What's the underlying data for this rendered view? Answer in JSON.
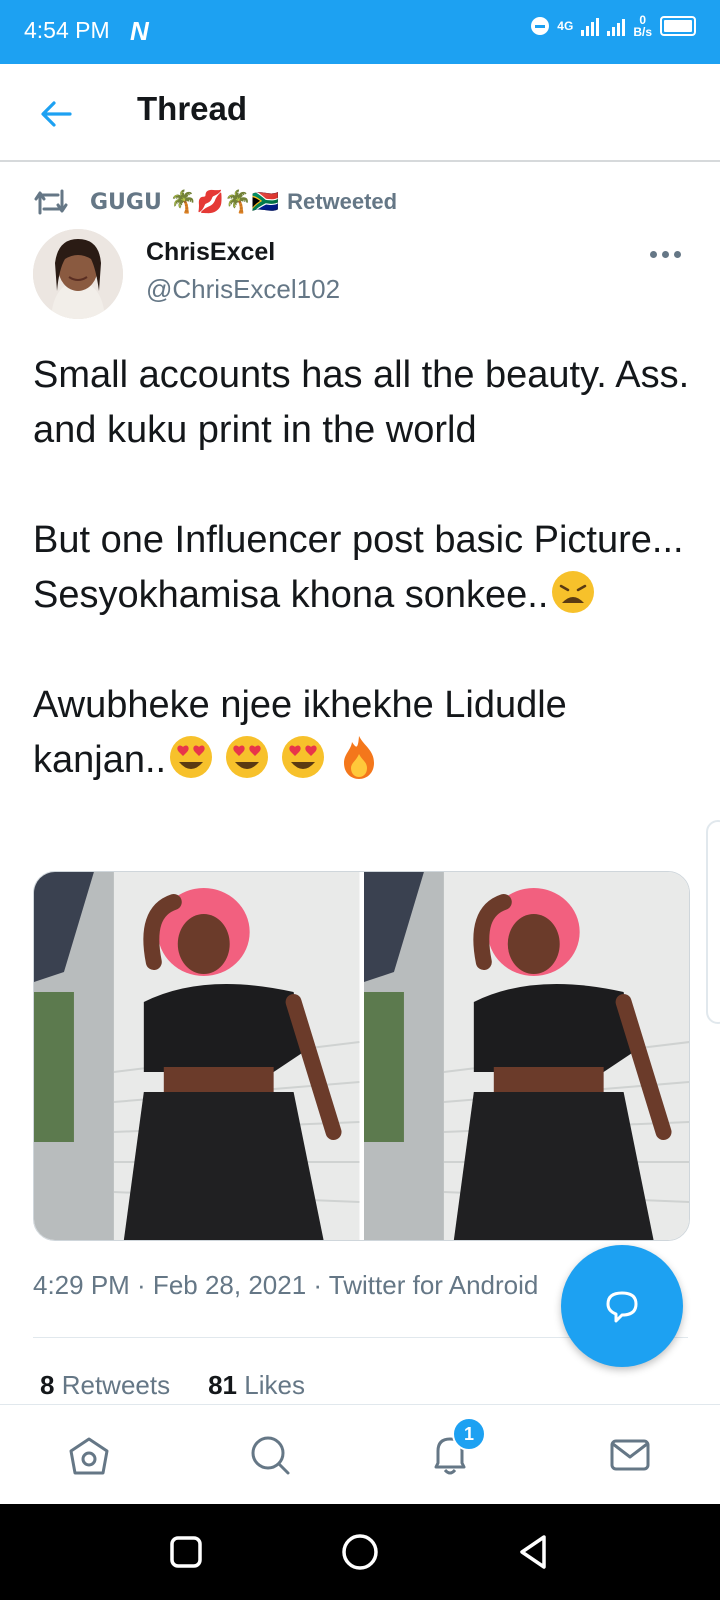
{
  "status_bar": {
    "time": "4:54 PM",
    "network": "4G",
    "data_rate_value": "0",
    "data_rate_unit": "B/s"
  },
  "header": {
    "title": "Thread"
  },
  "tweet": {
    "retweeted_by": "GUGU 🌴💋🌴🇿🇦",
    "retweeted_label": "Retweeted",
    "author_name": "ChrisExcel",
    "author_handle": "@ChrisExcel102",
    "text_p1": "Small accounts has all the beauty. Ass. and kuku print in the world",
    "text_p2": "But one Influencer post basic Picture... Sesyokhamisa khona sonkee..",
    "text_p3": "Awubheke njee ikhekhe Lidudle kanjan..",
    "timestamp": "4:29 PM · Feb 28, 2021 · Twitter for Android",
    "retweets_count": "8",
    "retweets_label": "Retweets",
    "likes_count": "81",
    "likes_label": "Likes"
  },
  "bottom_nav": {
    "notifications_badge": "1",
    "items": [
      "home-icon",
      "search-icon",
      "notifications-icon",
      "messages-icon"
    ]
  },
  "colors": {
    "brand": "#1da1f2",
    "secondary_text": "#657786",
    "primary_text": "#14171a"
  }
}
